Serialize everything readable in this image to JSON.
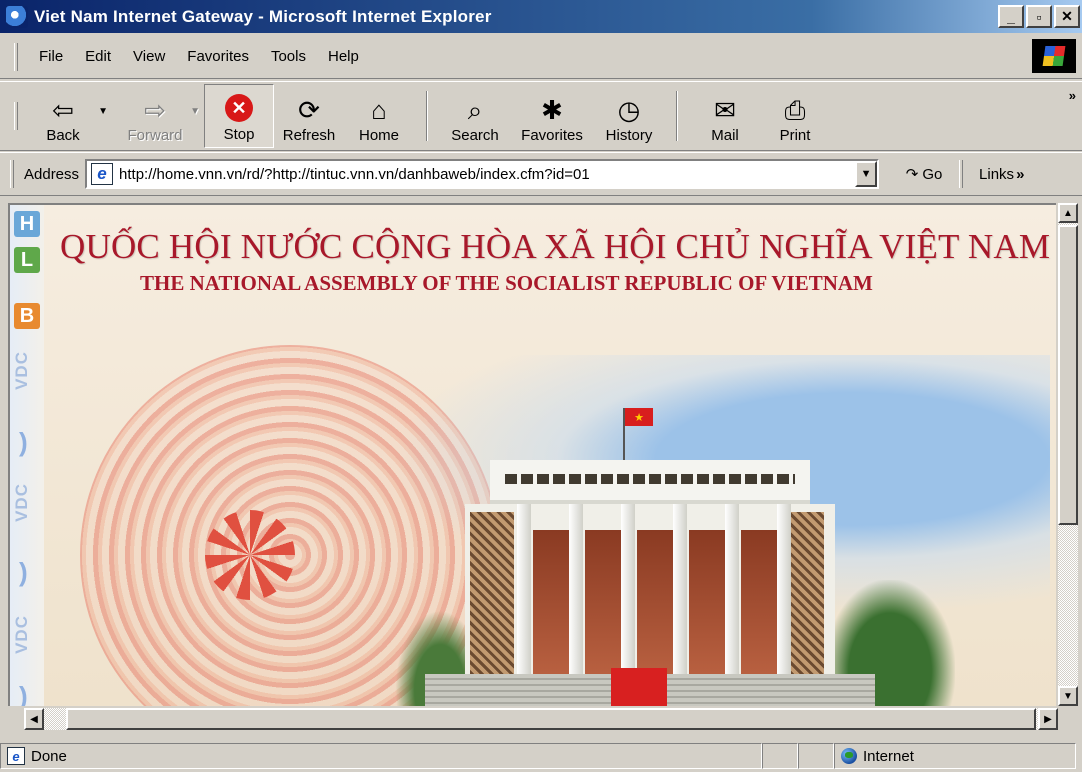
{
  "window": {
    "title": "Viet Nam Internet Gateway - Microsoft Internet Explorer",
    "controls": {
      "minimize": "_",
      "maximize": "▫",
      "close": "✕"
    }
  },
  "menu": {
    "items": [
      "File",
      "Edit",
      "View",
      "Favorites",
      "Tools",
      "Help"
    ]
  },
  "toolbar": {
    "back": "Back",
    "forward": "Forward",
    "stop": "Stop",
    "refresh": "Refresh",
    "home": "Home",
    "search": "Search",
    "favorites": "Favorites",
    "history": "History",
    "mail": "Mail",
    "print": "Print",
    "more": "»"
  },
  "address": {
    "label": "Address",
    "url": "http://home.vnn.vn/rd/?http://tintuc.vnn.vn/danhbaweb/index.cfm?id=01",
    "go": "Go",
    "links": "Links",
    "links_more": "»"
  },
  "page": {
    "side_badges": [
      "H",
      "L",
      "B"
    ],
    "side_brand": "VDC",
    "headline_vn": "QUỐC HỘI NƯỚC CỘNG HÒA XÃ HỘI CHỦ NGHĨA VIỆT NAM",
    "headline_en": "THE NATIONAL ASSEMBLY OF THE SOCIALIST REPUBLIC OF VIETNAM"
  },
  "status": {
    "text": "Done",
    "zone": "Internet"
  },
  "icons": {
    "back": "arrow-left-icon",
    "forward": "arrow-right-icon",
    "stop": "stop-icon",
    "refresh": "refresh-icon",
    "home": "home-icon",
    "search": "search-icon",
    "favorites": "favorites-icon",
    "history": "history-icon",
    "mail": "mail-icon",
    "print": "print-icon"
  },
  "colors": {
    "title_bar": "#0a246a",
    "headline": "#a8182a",
    "stop": "#d81818"
  }
}
